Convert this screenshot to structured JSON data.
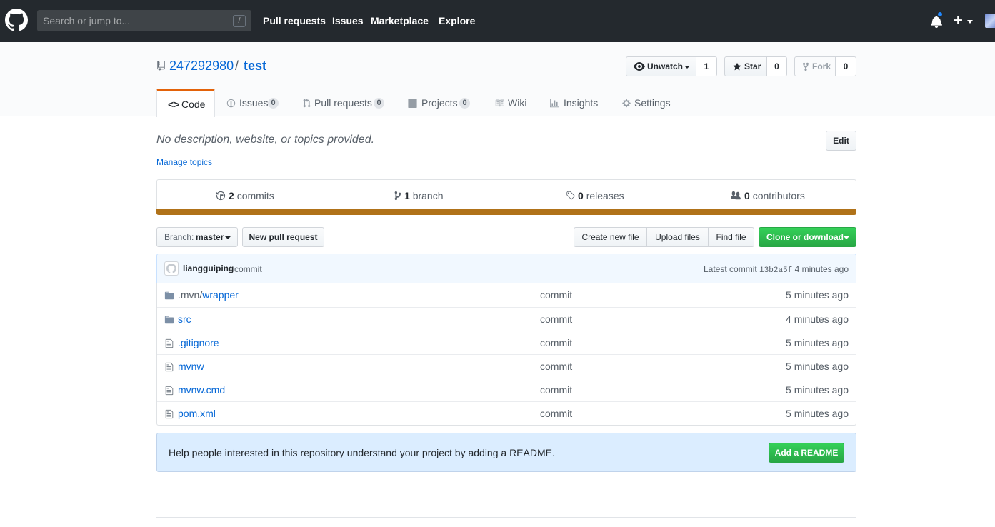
{
  "header": {
    "search_placeholder": "Search or jump to...",
    "search_shortcut": "/",
    "nav": [
      "Pull requests",
      "Issues",
      "Marketplace",
      "Explore"
    ],
    "plus_label": "+"
  },
  "repo": {
    "owner": "247292980",
    "separator": "/",
    "name": "test"
  },
  "actions": {
    "watch_label": "Unwatch",
    "watch_count": "1",
    "star_label": "Star",
    "star_count": "0",
    "fork_label": "Fork",
    "fork_count": "0"
  },
  "tabs": {
    "code": "Code",
    "issues": "Issues",
    "issues_count": "0",
    "pulls": "Pull requests",
    "pulls_count": "0",
    "projects": "Projects",
    "projects_count": "0",
    "wiki": "Wiki",
    "insights": "Insights",
    "settings": "Settings"
  },
  "description": {
    "text": "No description, website, or topics provided.",
    "manage_topics": "Manage topics",
    "edit_label": "Edit"
  },
  "summary": {
    "commits_num": "2",
    "commits_label": "commits",
    "branch_num": "1",
    "branch_label": "branch",
    "releases_num": "0",
    "releases_label": "releases",
    "contributors_num": "0",
    "contributors_label": "contributors",
    "language_color": "#b07219"
  },
  "file_nav": {
    "branch_prefix": "Branch:",
    "branch_name": "master",
    "new_pr": "New pull request",
    "create_file": "Create new file",
    "upload_files": "Upload files",
    "find_file": "Find file",
    "clone": "Clone or download"
  },
  "latest_commit": {
    "author": "liangguiping",
    "message": "commit",
    "prefix": "Latest commit",
    "sha": "13b2a5f",
    "age": "4 minutes ago"
  },
  "files": [
    {
      "name_prefix": ".mvn/",
      "name": "wrapper",
      "type": "dir",
      "message": "commit",
      "age": "5 minutes ago"
    },
    {
      "name_prefix": "",
      "name": "src",
      "type": "dir",
      "message": "commit",
      "age": "4 minutes ago"
    },
    {
      "name_prefix": "",
      "name": ".gitignore",
      "type": "file",
      "message": "commit",
      "age": "5 minutes ago"
    },
    {
      "name_prefix": "",
      "name": "mvnw",
      "type": "file",
      "message": "commit",
      "age": "5 minutes ago"
    },
    {
      "name_prefix": "",
      "name": "mvnw.cmd",
      "type": "file",
      "message": "commit",
      "age": "5 minutes ago"
    },
    {
      "name_prefix": "",
      "name": "pom.xml",
      "type": "file",
      "message": "commit",
      "age": "5 minutes ago"
    }
  ],
  "readme": {
    "text": "Help people interested in this repository understand your project by adding a README.",
    "button": "Add a README"
  },
  "colors": {
    "header_bg": "#24292e",
    "link": "#0366d6",
    "primary_green": "#28a745",
    "tab_accent": "#e36209"
  }
}
